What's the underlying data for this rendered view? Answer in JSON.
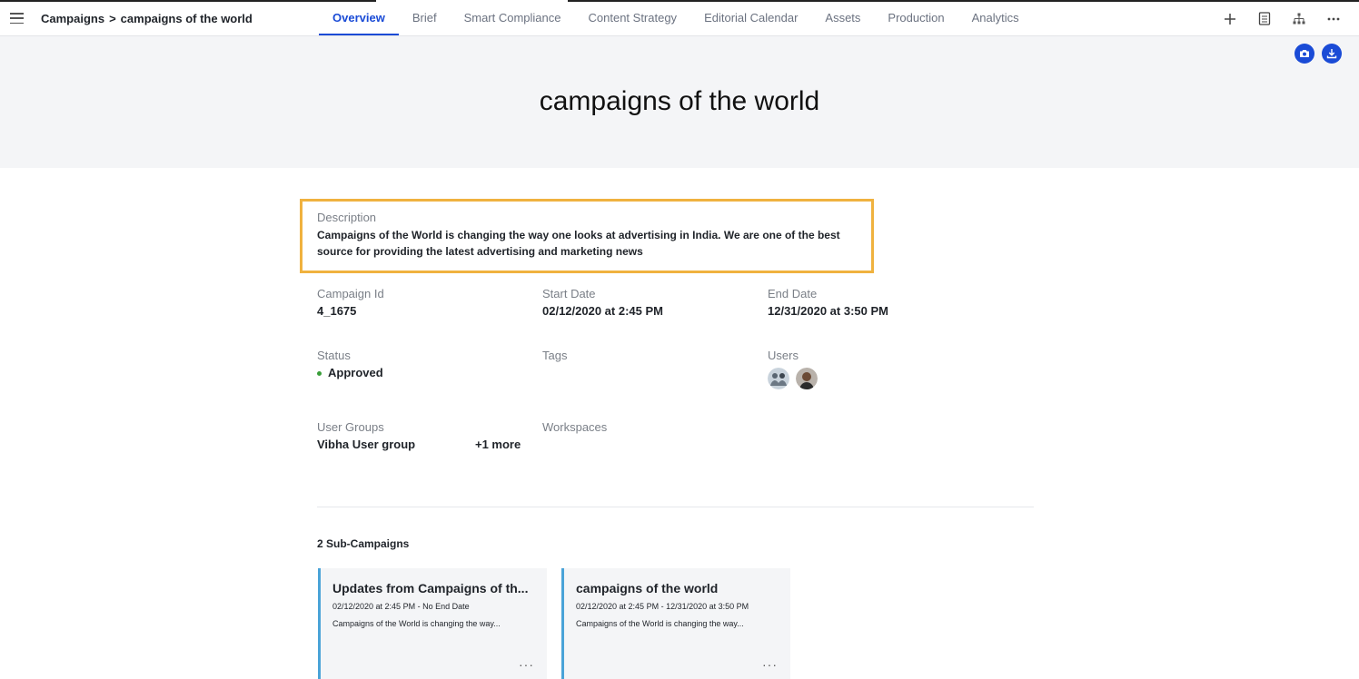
{
  "breadcrumb": {
    "parent": "Campaigns",
    "separator": ">",
    "current": "campaigns of the world"
  },
  "tabs": [
    {
      "label": "Overview",
      "active": true
    },
    {
      "label": "Brief"
    },
    {
      "label": "Smart Compliance"
    },
    {
      "label": "Content Strategy"
    },
    {
      "label": "Editorial Calendar"
    },
    {
      "label": "Assets"
    },
    {
      "label": "Production"
    },
    {
      "label": "Analytics"
    }
  ],
  "toolbar_icons": [
    "plus-icon",
    "document-icon",
    "hierarchy-icon",
    "more-icon"
  ],
  "hero": {
    "title": "campaigns of the world",
    "actions": [
      "camera-icon",
      "download-icon"
    ]
  },
  "description": {
    "label": "Description",
    "text": "Campaigns of the World is changing the way one looks at advertising in India. We are one of the best source for providing the latest advertising and marketing news"
  },
  "fields": {
    "campaign_id": {
      "label": "Campaign Id",
      "value": "4_1675"
    },
    "start_date": {
      "label": "Start Date",
      "value": "02/12/2020 at 2:45 PM"
    },
    "end_date": {
      "label": "End Date",
      "value": "12/31/2020 at 3:50 PM"
    },
    "status": {
      "label": "Status",
      "value": "Approved"
    },
    "tags": {
      "label": "Tags"
    },
    "users": {
      "label": "Users"
    },
    "user_groups": {
      "label": "User Groups",
      "value": "Vibha User group",
      "more": "+1 more"
    },
    "workspaces": {
      "label": "Workspaces"
    }
  },
  "sub_campaigns": {
    "heading": "2 Sub-Campaigns",
    "items": [
      {
        "title": "Updates from Campaigns of th...",
        "dates": "02/12/2020 at 2:45 PM - No End Date",
        "desc": "Campaigns of the World is changing the way..."
      },
      {
        "title": "campaigns of the world",
        "dates": "02/12/2020 at 2:45 PM - 12/31/2020 at 3:50 PM",
        "desc": "Campaigns of the World is changing the way..."
      }
    ],
    "more_label": "···"
  },
  "colors": {
    "accent": "#1a4bd6",
    "highlight_border": "#f0b23f",
    "card_border": "#4aa3d8",
    "status_approved": "#3a9e3a"
  }
}
